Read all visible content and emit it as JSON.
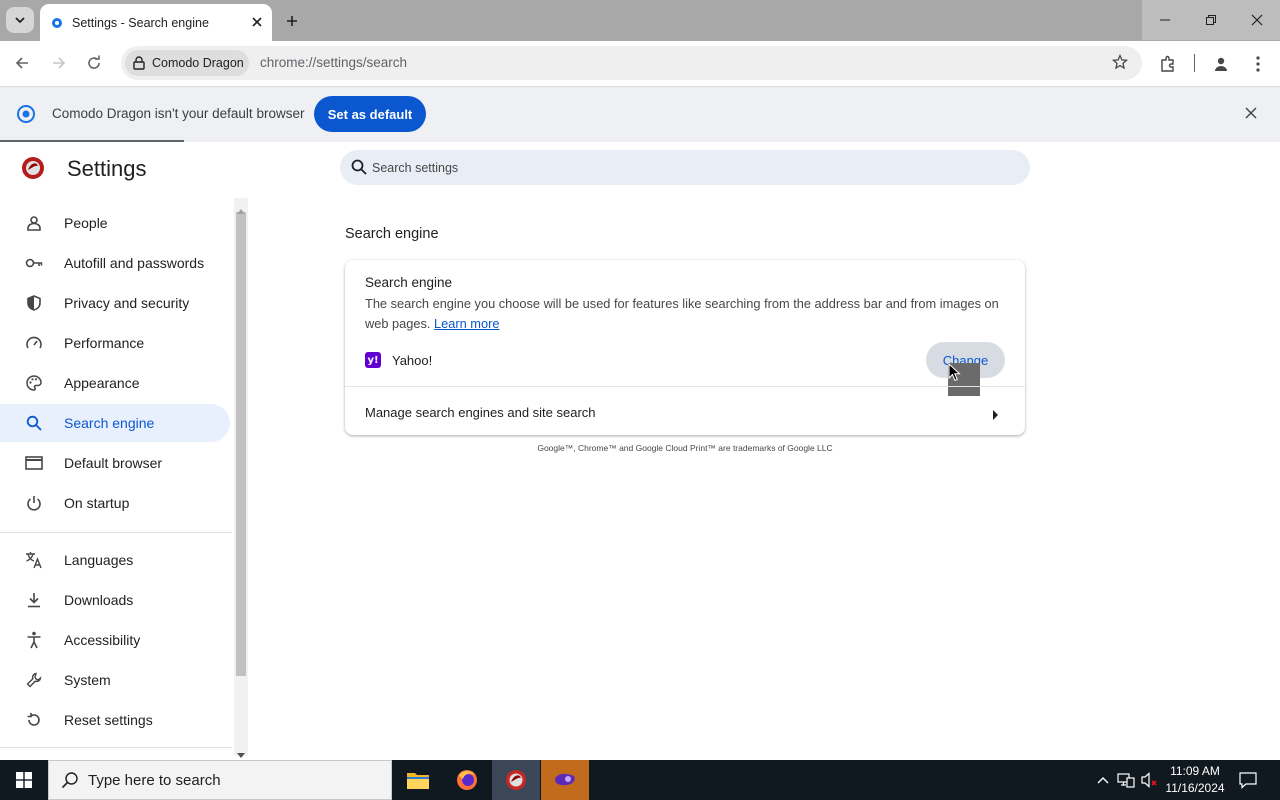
{
  "tab": {
    "title": "Settings - Search engine"
  },
  "toolbar": {
    "site_chip": "Comodo Dragon",
    "url": "chrome://settings/search"
  },
  "infobar": {
    "message": "Comodo Dragon isn't your default browser",
    "button": "Set as default"
  },
  "settings": {
    "title": "Settings",
    "search_placeholder": "Search settings"
  },
  "sidebar": {
    "items": [
      {
        "label": "People",
        "icon": "person-icon"
      },
      {
        "label": "Autofill and passwords",
        "icon": "key-icon"
      },
      {
        "label": "Privacy and security",
        "icon": "shield-icon"
      },
      {
        "label": "Performance",
        "icon": "speedometer-icon"
      },
      {
        "label": "Appearance",
        "icon": "palette-icon"
      },
      {
        "label": "Search engine",
        "icon": "search-icon",
        "active": true
      },
      {
        "label": "Default browser",
        "icon": "browser-window-icon"
      },
      {
        "label": "On startup",
        "icon": "power-icon"
      },
      {
        "label": "Languages",
        "icon": "translate-icon"
      },
      {
        "label": "Downloads",
        "icon": "download-icon"
      },
      {
        "label": "Accessibility",
        "icon": "accessibility-icon"
      },
      {
        "label": "System",
        "icon": "wrench-icon"
      },
      {
        "label": "Reset settings",
        "icon": "reset-icon"
      }
    ]
  },
  "main": {
    "section_title": "Search engine",
    "card": {
      "heading": "Search engine",
      "description": "The search engine you choose will be used for features like searching from the address bar and from images on web pages.",
      "learn_more": "Learn more",
      "engine_icon_text": "y!",
      "engine_name": "Yahoo!",
      "change_button": "Change",
      "manage_label": "Manage search engines and site search"
    },
    "trademark": "Google™, Chrome™ and Google Cloud Print™ are trademarks of Google LLC"
  },
  "taskbar": {
    "search_placeholder": "Type here to search",
    "time": "11:09 AM",
    "date": "11/16/2024"
  },
  "colors": {
    "accent": "#0b57d0",
    "active_nav_bg": "#e8f0fe",
    "yahoo": "#6001d2"
  }
}
